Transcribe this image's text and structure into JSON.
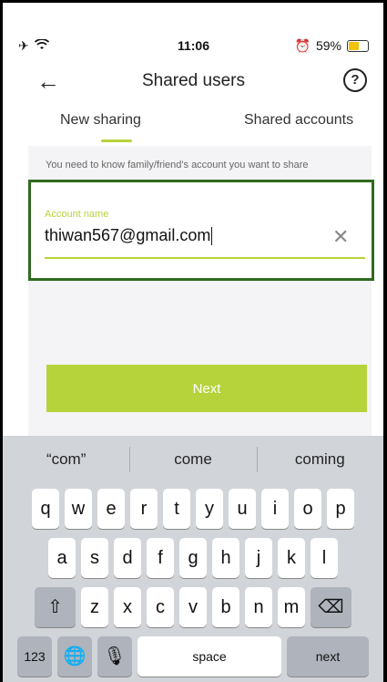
{
  "status": {
    "time": "11:06",
    "battery": "59%"
  },
  "nav": {
    "title": "Shared users",
    "help_label": "?"
  },
  "tabs": [
    {
      "label": "New sharing"
    },
    {
      "label": "Shared accounts"
    }
  ],
  "hint": "You need to know family/friend's account you want to share",
  "account": {
    "label": "Account name",
    "value": "thiwan567@gmail.com"
  },
  "next_label": "Next",
  "keyboard": {
    "suggestions": [
      "“com”",
      "come",
      "coming"
    ],
    "row1": [
      "q",
      "w",
      "e",
      "r",
      "t",
      "y",
      "u",
      "i",
      "o",
      "p"
    ],
    "row2": [
      "a",
      "s",
      "d",
      "f",
      "g",
      "h",
      "j",
      "k",
      "l"
    ],
    "row3": [
      "z",
      "x",
      "c",
      "v",
      "b",
      "n",
      "m"
    ],
    "num_label": "123",
    "space_label": "space",
    "next_label": "next"
  }
}
